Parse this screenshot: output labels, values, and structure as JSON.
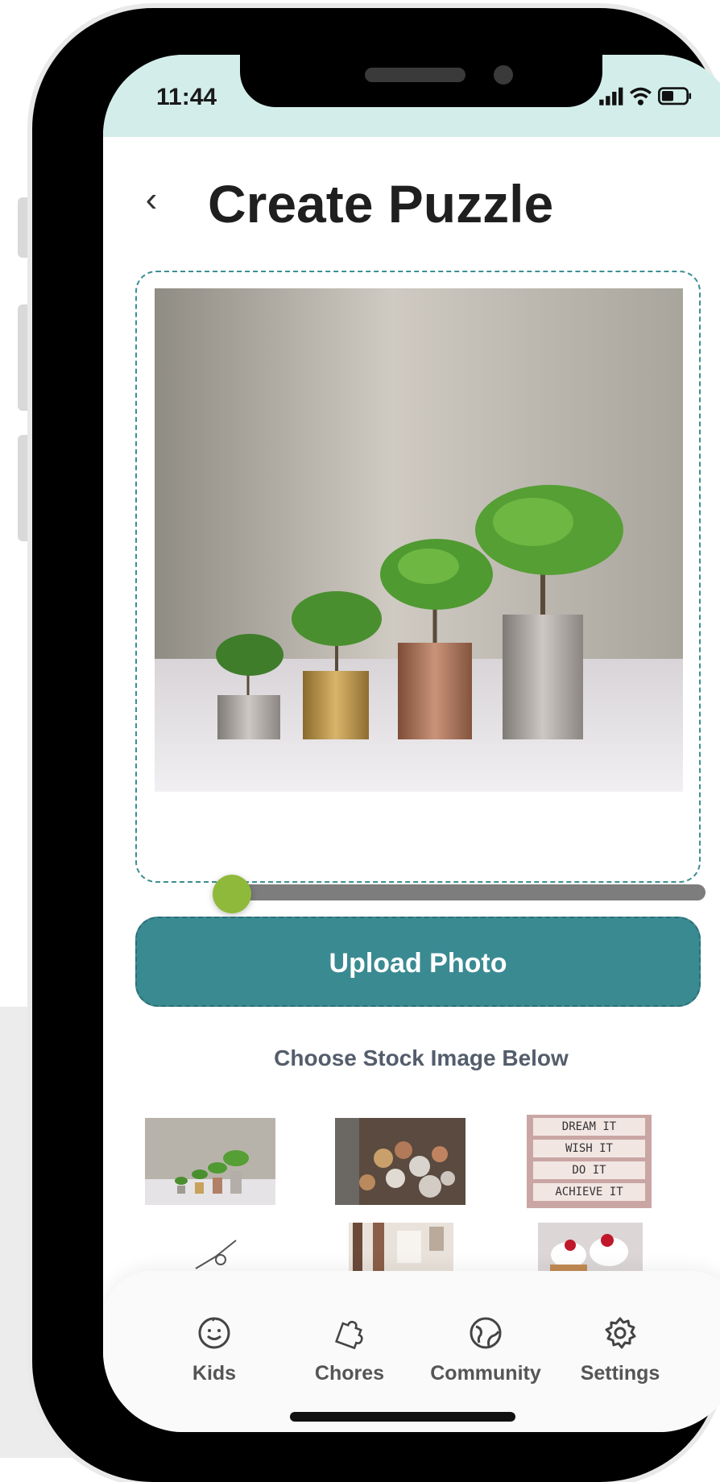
{
  "status_bar": {
    "time": "11:44"
  },
  "header": {
    "back_label": "‹",
    "title": "Create Puzzle"
  },
  "slider": {
    "value": 0.0
  },
  "upload_button": {
    "label": "Upload Photo"
  },
  "stock_section": {
    "label": "Choose Stock Image Below"
  },
  "stock_images": [
    {
      "name": "stock-trees-coins"
    },
    {
      "name": "stock-coins-jar"
    },
    {
      "name": "stock-dream-board",
      "lines": [
        "DREAM IT",
        "WISH IT",
        "DO IT",
        "ACHIEVE IT"
      ]
    },
    {
      "name": "stock-sketch"
    },
    {
      "name": "stock-room"
    },
    {
      "name": "stock-cupcakes"
    }
  ],
  "nav": {
    "items": [
      {
        "label": "Kids",
        "icon": "smiley-icon"
      },
      {
        "label": "Chores",
        "icon": "puzzle-icon"
      },
      {
        "label": "Community",
        "icon": "globe-icon"
      },
      {
        "label": "Settings",
        "icon": "gear-icon"
      }
    ]
  },
  "colors": {
    "accent": "#3a8a92",
    "status_bar_bg": "#d3eeea",
    "slider_thumb": "#8fb93b"
  }
}
